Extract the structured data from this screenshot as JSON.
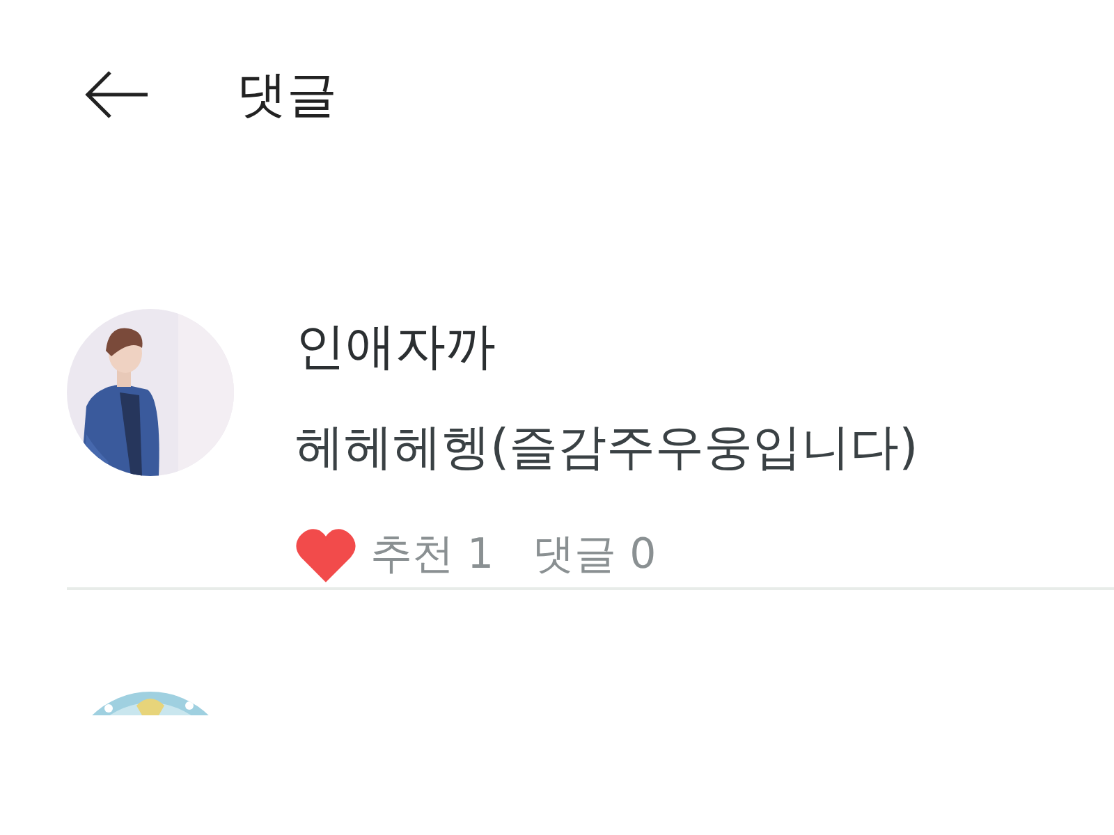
{
  "header": {
    "title": "댓글"
  },
  "comments": [
    {
      "name": "인애자까",
      "text": "헤헤헤헹(즐감주우웅입니다)",
      "liked": true,
      "likes_label": "추천 1",
      "replies_label": "댓글 0"
    }
  ]
}
